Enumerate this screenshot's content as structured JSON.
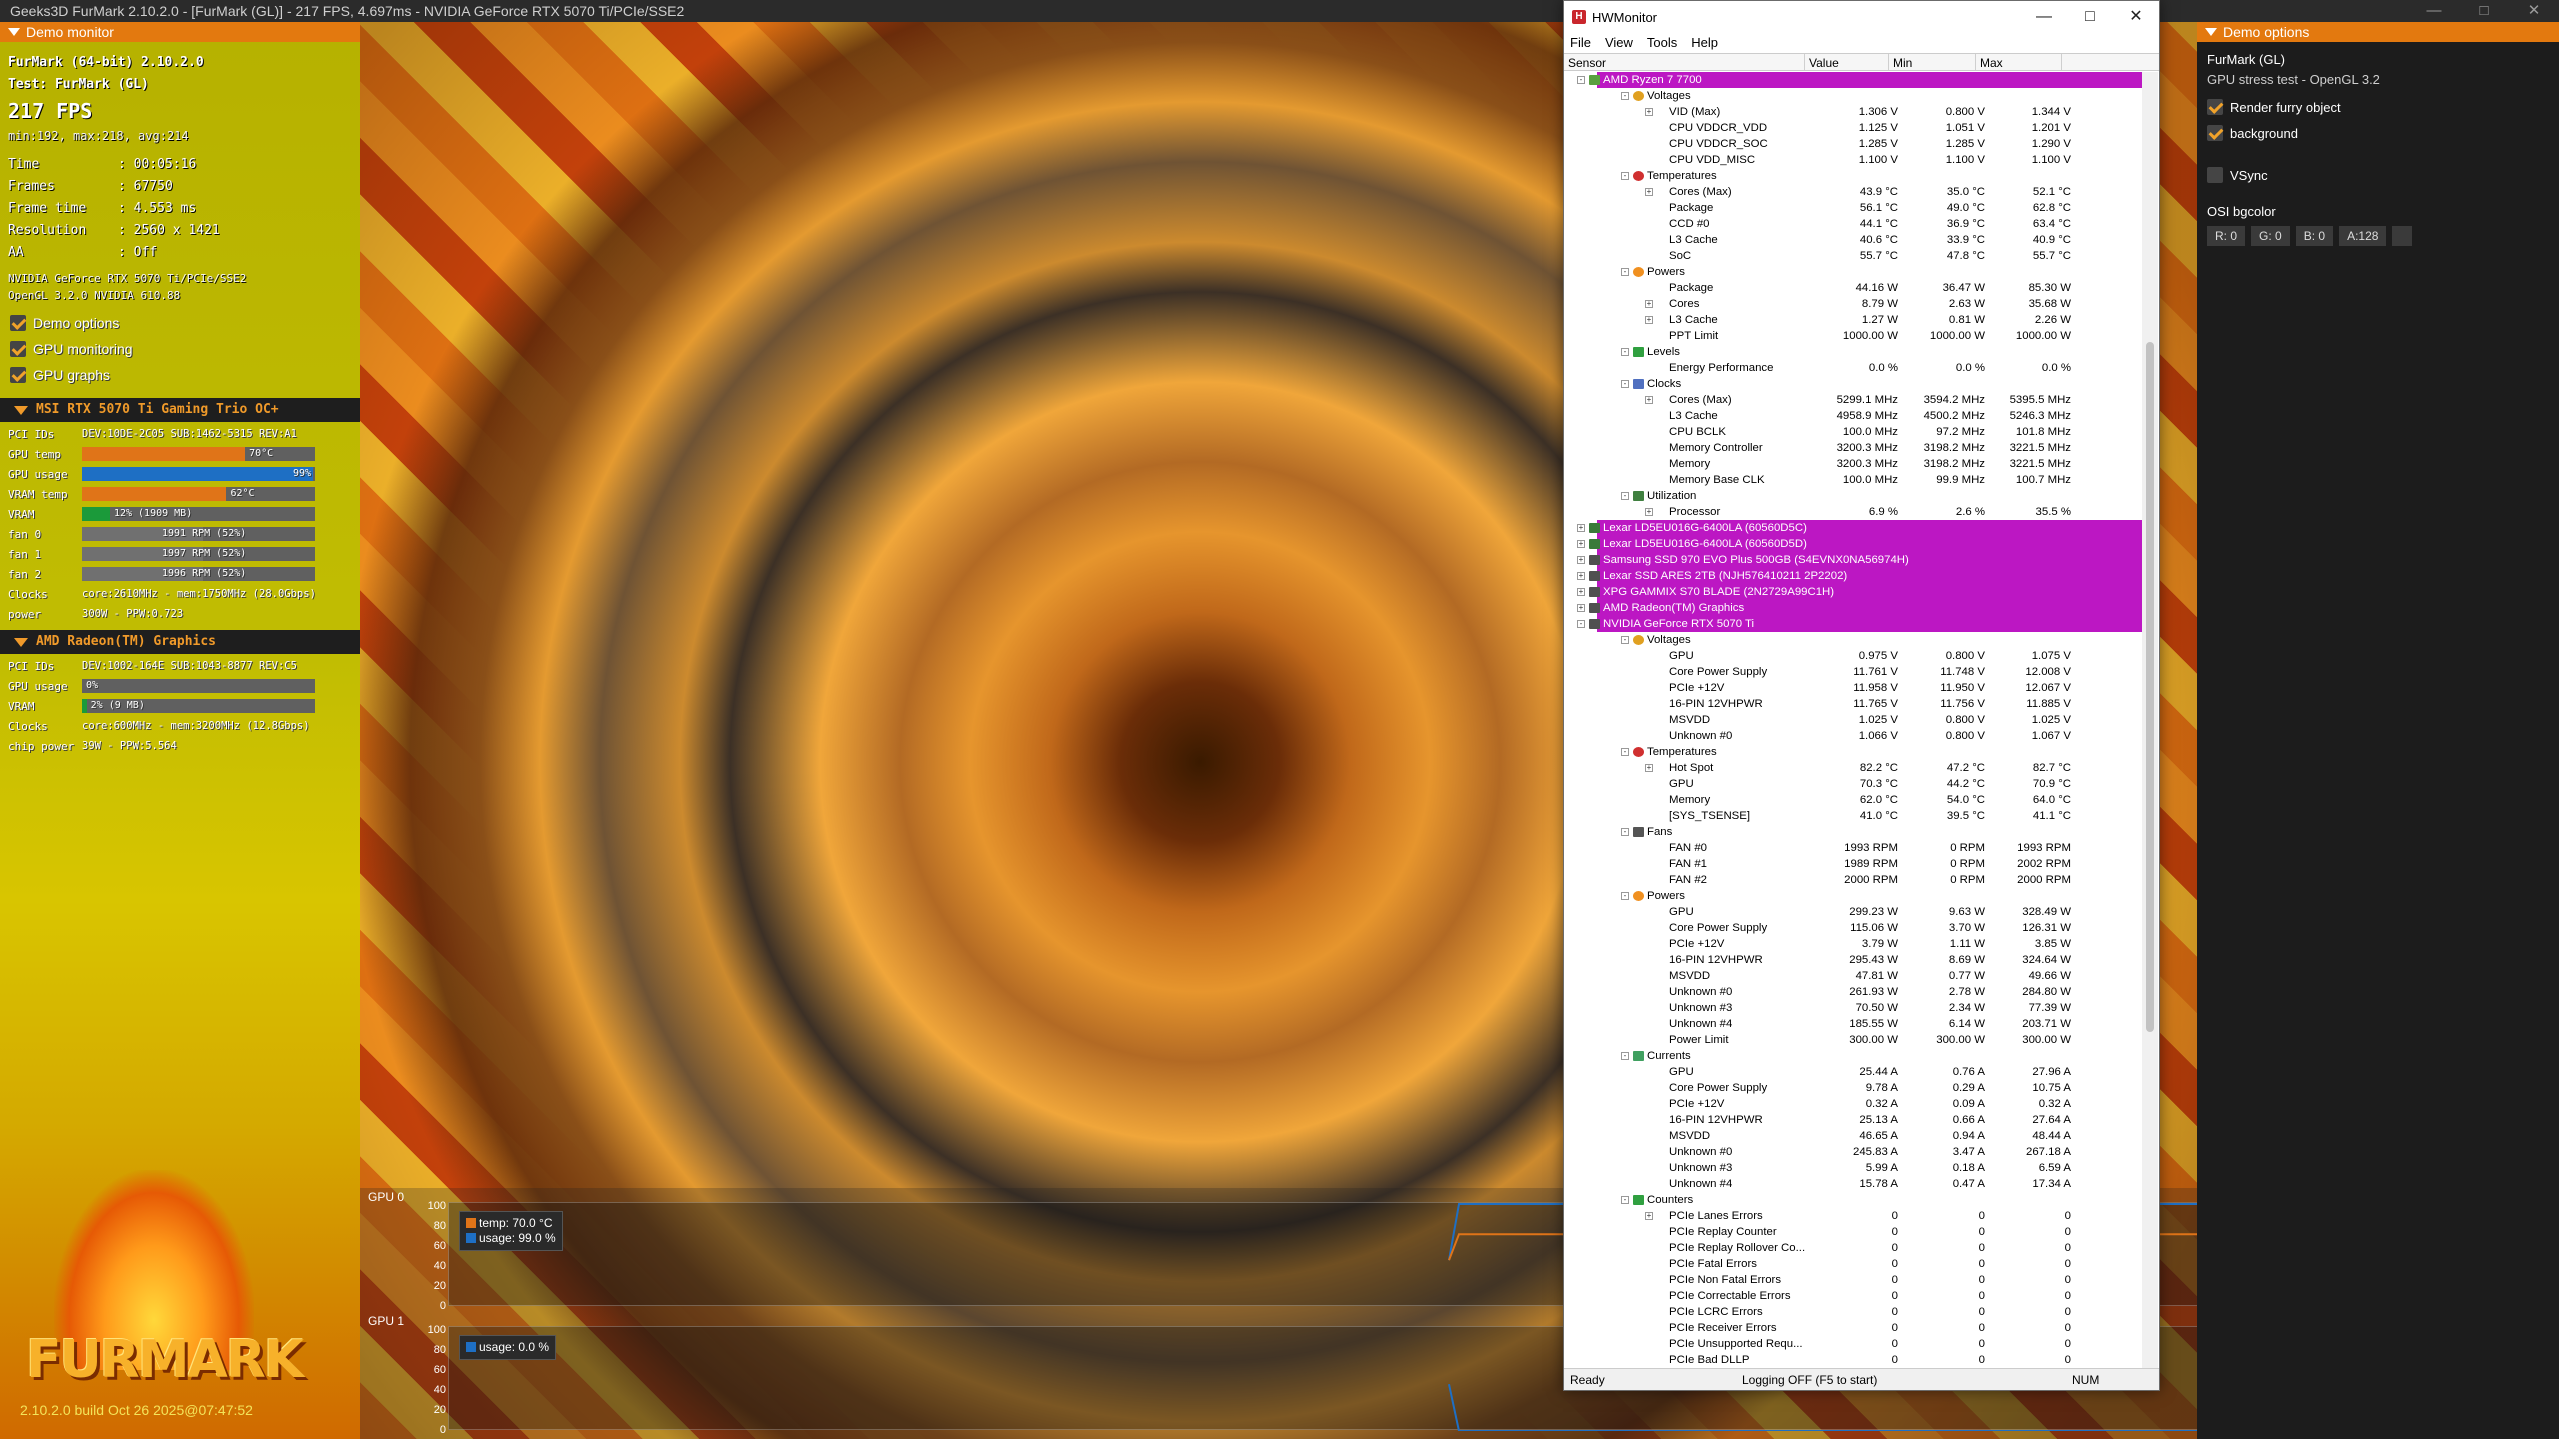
{
  "window_title": "Geeks3D FurMark 2.10.2.0 - [FurMark (GL)] - 217 FPS, 4.697ms - NVIDIA GeForce RTX 5070 Ti/PCIe/SSE2",
  "left_panel": {
    "header": "Demo monitor",
    "app_line": "FurMark (64-bit) 2.10.2.0",
    "test_line": "Test: FurMark (GL)",
    "fps": "217 FPS",
    "minmax": "min:192, max:218, avg:214",
    "stats": [
      [
        "Time",
        ": 00:05:16"
      ],
      [
        "Frames",
        ": 67750"
      ],
      [
        "Frame time",
        ": 4.553 ms"
      ],
      [
        "Resolution",
        ": 2560 x 1421"
      ],
      [
        "AA",
        ": Off"
      ]
    ],
    "gpu_line": "NVIDIA GeForce RTX 5070 Ti/PCIe/SSE2",
    "gl_line": "OpenGL 3.2.0 NVIDIA 610.88",
    "checks": [
      "Demo options",
      "GPU monitoring",
      "GPU graphs"
    ],
    "gpu0": {
      "title": "MSI RTX 5070 Ti Gaming Trio OC+",
      "rows": [
        {
          "k": "PCI IDs",
          "t": "DEV:10DE-2C05 SUB:1462-5315 REV:A1"
        },
        {
          "k": "GPU temp",
          "bar": true,
          "pct": 70,
          "color": "#e07418",
          "label": "70°C"
        },
        {
          "k": "GPU usage",
          "bar": true,
          "pct": 99,
          "color": "#1e6fc4",
          "label": "99%"
        },
        {
          "k": "VRAM temp",
          "bar": true,
          "pct": 62,
          "color": "#e07418",
          "label": "62°C"
        },
        {
          "k": "VRAM",
          "bar": true,
          "pct": 12,
          "color": "#1b9a3a",
          "label": "12% (1909 MB)"
        },
        {
          "k": "fan 0",
          "bar": true,
          "pct": 52,
          "color": "#707070",
          "label": "1991 RPM (52%)"
        },
        {
          "k": "fan 1",
          "bar": true,
          "pct": 52,
          "color": "#707070",
          "label": "1997 RPM (52%)"
        },
        {
          "k": "fan 2",
          "bar": true,
          "pct": 52,
          "color": "#707070",
          "label": "1996 RPM (52%)"
        },
        {
          "k": "Clocks",
          "t": "core:2610MHz - mem:1750MHz (28.0Gbps)"
        },
        {
          "k": "power",
          "t": "300W - PPW:0.723"
        }
      ]
    },
    "gpu1": {
      "title": "AMD Radeon(TM) Graphics",
      "rows": [
        {
          "k": "PCI IDs",
          "t": "DEV:1002-164E SUB:1043-8877 REV:C5"
        },
        {
          "k": "GPU usage",
          "bar": true,
          "pct": 0,
          "color": "#1e6fc4",
          "label": "0%"
        },
        {
          "k": "VRAM",
          "bar": true,
          "pct": 2,
          "color": "#1b9a3a",
          "label": "2% (9 MB)"
        },
        {
          "k": "Clocks",
          "t": "core:600MHz - mem:3200MHz (12.8Gbps)"
        },
        {
          "k": "chip power",
          "t": "39W - PPW:5.564"
        }
      ]
    },
    "logo_text": "FURMARK",
    "build": "2.10.2.0 build Oct 26 2025@07:47:52"
  },
  "graphs": [
    {
      "name": "GPU 0",
      "ticks": [
        "100",
        "80",
        "60",
        "40",
        "20",
        "0"
      ],
      "legend": [
        {
          "text": "temp: 70.0 °C",
          "color": "#e07418"
        },
        {
          "text": "usage: 99.0 %",
          "color": "#1e6fc4"
        }
      ],
      "temp": 70,
      "usage": 99
    },
    {
      "name": "GPU 1",
      "ticks": [
        "100",
        "80",
        "60",
        "40",
        "20",
        "0"
      ],
      "legend": [
        {
          "text": "usage: 0.0 %",
          "color": "#1e6fc4"
        }
      ],
      "usage": 0
    }
  ],
  "hwmonitor": {
    "title": "HWMonitor",
    "menu": [
      "File",
      "View",
      "Tools",
      "Help"
    ],
    "columns": [
      "Sensor",
      "Value",
      "Min",
      "Max"
    ],
    "rows": [
      {
        "d": 0,
        "n": "AMD Ryzen 7 7700",
        "p": 1,
        "i": "cpu",
        "e": "-"
      },
      {
        "d": 1,
        "n": "Voltages",
        "i": "volt",
        "e": "-"
      },
      {
        "d": 2,
        "n": "VID (Max)",
        "v": "1.306 V",
        "mi": "0.800 V",
        "ma": "1.344 V",
        "e": "+"
      },
      {
        "d": 2,
        "n": "CPU VDDCR_VDD",
        "v": "1.125 V",
        "mi": "1.051 V",
        "ma": "1.201 V"
      },
      {
        "d": 2,
        "n": "CPU VDDCR_SOC",
        "v": "1.285 V",
        "mi": "1.285 V",
        "ma": "1.290 V"
      },
      {
        "d": 2,
        "n": "CPU VDD_MISC",
        "v": "1.100 V",
        "mi": "1.100 V",
        "ma": "1.100 V"
      },
      {
        "d": 1,
        "n": "Temperatures",
        "i": "temp",
        "e": "-"
      },
      {
        "d": 2,
        "n": "Cores (Max)",
        "v": "43.9 °C",
        "mi": "35.0 °C",
        "ma": "52.1 °C",
        "e": "+"
      },
      {
        "d": 2,
        "n": "Package",
        "v": "56.1 °C",
        "mi": "49.0 °C",
        "ma": "62.8 °C"
      },
      {
        "d": 2,
        "n": "CCD #0",
        "v": "44.1 °C",
        "mi": "36.9 °C",
        "ma": "63.4 °C"
      },
      {
        "d": 2,
        "n": "L3 Cache",
        "v": "40.6 °C",
        "mi": "33.9 °C",
        "ma": "40.9 °C"
      },
      {
        "d": 2,
        "n": "SoC",
        "v": "55.7 °C",
        "mi": "47.8 °C",
        "ma": "55.7 °C"
      },
      {
        "d": 1,
        "n": "Powers",
        "i": "power",
        "e": "-"
      },
      {
        "d": 2,
        "n": "Package",
        "v": "44.16 W",
        "mi": "36.47 W",
        "ma": "85.30 W"
      },
      {
        "d": 2,
        "n": "Cores",
        "v": "8.79 W",
        "mi": "2.63 W",
        "ma": "35.68 W",
        "e": "+"
      },
      {
        "d": 2,
        "n": "L3 Cache",
        "v": "1.27 W",
        "mi": "0.81 W",
        "ma": "2.26 W",
        "e": "+"
      },
      {
        "d": 2,
        "n": "PPT Limit",
        "v": "1000.00 W",
        "mi": "1000.00 W",
        "ma": "1000.00 W"
      },
      {
        "d": 1,
        "n": "Levels",
        "i": "level",
        "e": "-"
      },
      {
        "d": 2,
        "n": "Energy Performance",
        "v": "0.0 %",
        "mi": "0.0 %",
        "ma": "0.0 %"
      },
      {
        "d": 1,
        "n": "Clocks",
        "i": "clock",
        "e": "-"
      },
      {
        "d": 2,
        "n": "Cores (Max)",
        "v": "5299.1 MHz",
        "mi": "3594.2 MHz",
        "ma": "5395.5 MHz",
        "e": "+"
      },
      {
        "d": 2,
        "n": "L3 Cache",
        "v": "4958.9 MHz",
        "mi": "4500.2 MHz",
        "ma": "5246.3 MHz"
      },
      {
        "d": 2,
        "n": "CPU BCLK",
        "v": "100.0 MHz",
        "mi": "97.2 MHz",
        "ma": "101.8 MHz"
      },
      {
        "d": 2,
        "n": "Memory Controller",
        "v": "3200.3 MHz",
        "mi": "3198.2 MHz",
        "ma": "3221.5 MHz"
      },
      {
        "d": 2,
        "n": "Memory",
        "v": "3200.3 MHz",
        "mi": "3198.2 MHz",
        "ma": "3221.5 MHz"
      },
      {
        "d": 2,
        "n": "Memory Base CLK",
        "v": "100.0 MHz",
        "mi": "99.9 MHz",
        "ma": "100.7 MHz"
      },
      {
        "d": 1,
        "n": "Utilization",
        "i": "util",
        "e": "-"
      },
      {
        "d": 2,
        "n": "Processor",
        "v": "6.9 %",
        "mi": "2.6 %",
        "ma": "35.5 %",
        "e": "+"
      },
      {
        "d": 0,
        "n": "Lexar LD5EU016G-6400LA (60560D5C)",
        "p": 1,
        "i": "ram",
        "e": "+"
      },
      {
        "d": 0,
        "n": "Lexar LD5EU016G-6400LA (60560D5D)",
        "p": 1,
        "i": "ram",
        "e": "+"
      },
      {
        "d": 0,
        "n": "Samsung SSD 970 EVO Plus 500GB (S4EVNX0NA56974H)",
        "p": 1,
        "i": "disk",
        "e": "+"
      },
      {
        "d": 0,
        "n": "Lexar SSD ARES 2TB (NJH576410211 2P2202)",
        "p": 1,
        "i": "disk",
        "e": "+"
      },
      {
        "d": 0,
        "n": "XPG GAMMIX S70 BLADE (2N2729A99C1H)",
        "p": 1,
        "i": "disk",
        "e": "+"
      },
      {
        "d": 0,
        "n": "AMD Radeon(TM) Graphics",
        "p": 1,
        "i": "gpu",
        "e": "+"
      },
      {
        "d": 0,
        "n": "NVIDIA GeForce RTX 5070 Ti",
        "p": 1,
        "i": "gpu",
        "e": "-"
      },
      {
        "d": 1,
        "n": "Voltages",
        "i": "volt",
        "e": "-"
      },
      {
        "d": 2,
        "n": "GPU",
        "v": "0.975 V",
        "mi": "0.800 V",
        "ma": "1.075 V"
      },
      {
        "d": 2,
        "n": "Core Power Supply",
        "v": "11.761 V",
        "mi": "11.748 V",
        "ma": "12.008 V"
      },
      {
        "d": 2,
        "n": "PCIe +12V",
        "v": "11.958 V",
        "mi": "11.950 V",
        "ma": "12.067 V"
      },
      {
        "d": 2,
        "n": "16-PIN 12VHPWR",
        "v": "11.765 V",
        "mi": "11.756 V",
        "ma": "11.885 V"
      },
      {
        "d": 2,
        "n": "MSVDD",
        "v": "1.025 V",
        "mi": "0.800 V",
        "ma": "1.025 V"
      },
      {
        "d": 2,
        "n": "Unknown #0",
        "v": "1.066 V",
        "mi": "0.800 V",
        "ma": "1.067 V"
      },
      {
        "d": 1,
        "n": "Temperatures",
        "i": "temp",
        "e": "-"
      },
      {
        "d": 2,
        "n": "Hot Spot",
        "v": "82.2 °C",
        "mi": "47.2 °C",
        "ma": "82.7 °C",
        "e": "+"
      },
      {
        "d": 2,
        "n": "GPU",
        "v": "70.3 °C",
        "mi": "44.2 °C",
        "ma": "70.9 °C"
      },
      {
        "d": 2,
        "n": "Memory",
        "v": "62.0 °C",
        "mi": "54.0 °C",
        "ma": "64.0 °C"
      },
      {
        "d": 2,
        "n": "[SYS_TSENSE]",
        "v": "41.0 °C",
        "mi": "39.5 °C",
        "ma": "41.1 °C"
      },
      {
        "d": 1,
        "n": "Fans",
        "i": "fan",
        "e": "-"
      },
      {
        "d": 2,
        "n": "FAN #0",
        "v": "1993 RPM",
        "mi": "0 RPM",
        "ma": "1993 RPM"
      },
      {
        "d": 2,
        "n": "FAN #1",
        "v": "1989 RPM",
        "mi": "0 RPM",
        "ma": "2002 RPM"
      },
      {
        "d": 2,
        "n": "FAN #2",
        "v": "2000 RPM",
        "mi": "0 RPM",
        "ma": "2000 RPM"
      },
      {
        "d": 1,
        "n": "Powers",
        "i": "power",
        "e": "-"
      },
      {
        "d": 2,
        "n": "GPU",
        "v": "299.23 W",
        "mi": "9.63 W",
        "ma": "328.49 W"
      },
      {
        "d": 2,
        "n": "Core Power Supply",
        "v": "115.06 W",
        "mi": "3.70 W",
        "ma": "126.31 W"
      },
      {
        "d": 2,
        "n": "PCIe +12V",
        "v": "3.79 W",
        "mi": "1.11 W",
        "ma": "3.85 W"
      },
      {
        "d": 2,
        "n": "16-PIN 12VHPWR",
        "v": "295.43 W",
        "mi": "8.69 W",
        "ma": "324.64 W"
      },
      {
        "d": 2,
        "n": "MSVDD",
        "v": "47.81 W",
        "mi": "0.77 W",
        "ma": "49.66 W"
      },
      {
        "d": 2,
        "n": "Unknown #0",
        "v": "261.93 W",
        "mi": "2.78 W",
        "ma": "284.80 W"
      },
      {
        "d": 2,
        "n": "Unknown #3",
        "v": "70.50 W",
        "mi": "2.34 W",
        "ma": "77.39 W"
      },
      {
        "d": 2,
        "n": "Unknown #4",
        "v": "185.55 W",
        "mi": "6.14 W",
        "ma": "203.71 W"
      },
      {
        "d": 2,
        "n": "Power Limit",
        "v": "300.00 W",
        "mi": "300.00 W",
        "ma": "300.00 W"
      },
      {
        "d": 1,
        "n": "Currents",
        "i": "curr",
        "e": "-"
      },
      {
        "d": 2,
        "n": "GPU",
        "v": "25.44 A",
        "mi": "0.76 A",
        "ma": "27.96 A"
      },
      {
        "d": 2,
        "n": "Core Power Supply",
        "v": "9.78 A",
        "mi": "0.29 A",
        "ma": "10.75 A"
      },
      {
        "d": 2,
        "n": "PCIe +12V",
        "v": "0.32 A",
        "mi": "0.09 A",
        "ma": "0.32 A"
      },
      {
        "d": 2,
        "n": "16-PIN 12VHPWR",
        "v": "25.13 A",
        "mi": "0.66 A",
        "ma": "27.64 A"
      },
      {
        "d": 2,
        "n": "MSVDD",
        "v": "46.65 A",
        "mi": "0.94 A",
        "ma": "48.44 A"
      },
      {
        "d": 2,
        "n": "Unknown #0",
        "v": "245.83 A",
        "mi": "3.47 A",
        "ma": "267.18 A"
      },
      {
        "d": 2,
        "n": "Unknown #3",
        "v": "5.99 A",
        "mi": "0.18 A",
        "ma": "6.59 A"
      },
      {
        "d": 2,
        "n": "Unknown #4",
        "v": "15.78 A",
        "mi": "0.47 A",
        "ma": "17.34 A"
      },
      {
        "d": 1,
        "n": "Counters",
        "i": "level",
        "e": "-"
      },
      {
        "d": 2,
        "n": "PCIe Lanes Errors",
        "v": "0",
        "mi": "0",
        "ma": "0",
        "e": "+"
      },
      {
        "d": 2,
        "n": "PCIe Replay Counter",
        "v": "0",
        "mi": "0",
        "ma": "0"
      },
      {
        "d": 2,
        "n": "PCIe Replay Rollover Co...",
        "v": "0",
        "mi": "0",
        "ma": "0"
      },
      {
        "d": 2,
        "n": "PCIe Fatal Errors",
        "v": "0",
        "mi": "0",
        "ma": "0"
      },
      {
        "d": 2,
        "n": "PCIe Non Fatal Errors",
        "v": "0",
        "mi": "0",
        "ma": "0"
      },
      {
        "d": 2,
        "n": "PCIe Correctable Errors",
        "v": "0",
        "mi": "0",
        "ma": "0"
      },
      {
        "d": 2,
        "n": "PCIe LCRC Errors",
        "v": "0",
        "mi": "0",
        "ma": "0"
      },
      {
        "d": 2,
        "n": "PCIe Receiver Errors",
        "v": "0",
        "mi": "0",
        "ma": "0"
      },
      {
        "d": 2,
        "n": "PCIe Unsupported Requ...",
        "v": "0",
        "mi": "0",
        "ma": "0"
      },
      {
        "d": 2,
        "n": "PCIe Bad DLLP",
        "v": "0",
        "mi": "0",
        "ma": "0"
      }
    ],
    "status": {
      "left": "Ready",
      "mid": "Logging OFF (F5 to start)",
      "num": "NUM"
    }
  },
  "right_panel": {
    "header": "Demo options",
    "title": "FurMark (GL)",
    "subtitle": "GPU stress test - OpenGL 3.2",
    "options": [
      {
        "label": "Render furry object",
        "on": true
      },
      {
        "label": "background",
        "on": true
      },
      {
        "label": "VSync",
        "on": false
      }
    ],
    "bg_label": "OSI bgcolor",
    "rgba": [
      "R: 0",
      "G: 0",
      "B: 0",
      "A:128"
    ]
  }
}
